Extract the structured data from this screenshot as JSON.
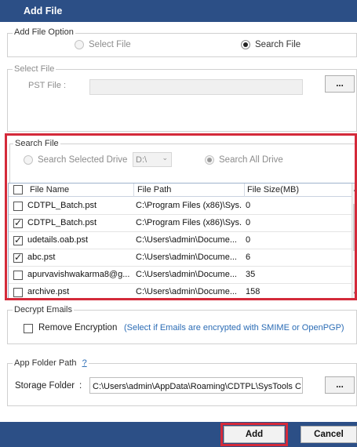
{
  "title": "Add File",
  "add_option": {
    "legend": "Add File Option",
    "select_label": "Select File",
    "search_label": "Search File",
    "selected": "search"
  },
  "select_file": {
    "legend": "Select File",
    "pst_label": "PST File :",
    "pst_value": "",
    "browse_label": "..."
  },
  "search_file": {
    "legend": "Search File",
    "selected_drive_label": "Search Selected Drive",
    "drive_value": "D:\\",
    "all_drive_label": "Search All Drive"
  },
  "table": {
    "headers": [
      "File Name",
      "File Path",
      "File Size(MB)"
    ],
    "rows": [
      {
        "checked": false,
        "name": "CDTPL_Batch.pst",
        "path": "C:\\Program Files (x86)\\Sys...",
        "size": "0"
      },
      {
        "checked": true,
        "name": "CDTPL_Batch.pst",
        "path": "C:\\Program Files (x86)\\Sys...",
        "size": "0"
      },
      {
        "checked": true,
        "name": "udetails.oab.pst",
        "path": "C:\\Users\\admin\\Docume...",
        "size": "0"
      },
      {
        "checked": true,
        "name": "abc.pst",
        "path": "C:\\Users\\admin\\Docume...",
        "size": "6"
      },
      {
        "checked": false,
        "name": "apurvavishwakarma8@g...",
        "path": "C:\\Users\\admin\\Docume...",
        "size": "35"
      },
      {
        "checked": false,
        "name": "archive.pst",
        "path": "C:\\Users\\admin\\Docume...",
        "size": "158"
      }
    ]
  },
  "decrypt": {
    "legend": "Decrypt Emails",
    "remove_label": "Remove Encryption",
    "hint": "(Select if Emails are encrypted with SMIME or OpenPGP)"
  },
  "app_folder": {
    "legend": "App Folder Path",
    "help": "?",
    "storage_label": "Storage Folder",
    "colon": ":",
    "storage_value": "C:\\Users\\admin\\AppData\\Roaming\\CDTPL\\SysTools C",
    "browse_label": "..."
  },
  "buttons": {
    "add": "Add",
    "cancel": "Cancel"
  },
  "colors": {
    "titlebar": "#2c4f86",
    "highlight": "#d42a3a",
    "link": "#2b6cb5"
  }
}
